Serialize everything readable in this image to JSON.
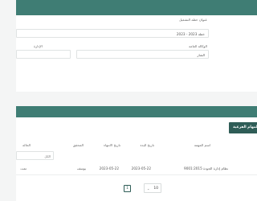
{
  "plan": {
    "name_label": "عنوان خطة التشغيل",
    "name_value": "خطة 2023 - 2023",
    "agency_label": "الوكالة العامة",
    "agency_value": "الشار",
    "department_label": "الإدارة"
  },
  "tasks": {
    "sub_tasks_button": "المهام الفرعية",
    "columns": [
      "اسم المهمة",
      "تاريخ البدء",
      "تاريخ الانتهاء",
      "المحقق",
      "الحالة"
    ],
    "filter_value": "الكل",
    "rows": [
      {
        "name": "نظام إدارة الجودة 9001:2015",
        "start": "2023-05-22",
        "end": "2023-05-22",
        "assignee": "يوسف",
        "status": "تمت"
      }
    ]
  },
  "pagination": {
    "current_page": "1",
    "page_size": "10",
    "chevron_icon": "chevron-down-icon"
  },
  "colors": {
    "header_teal": "#3f7d74",
    "button_dark_teal": "#2f5d57",
    "background": "#f4f5f5"
  }
}
